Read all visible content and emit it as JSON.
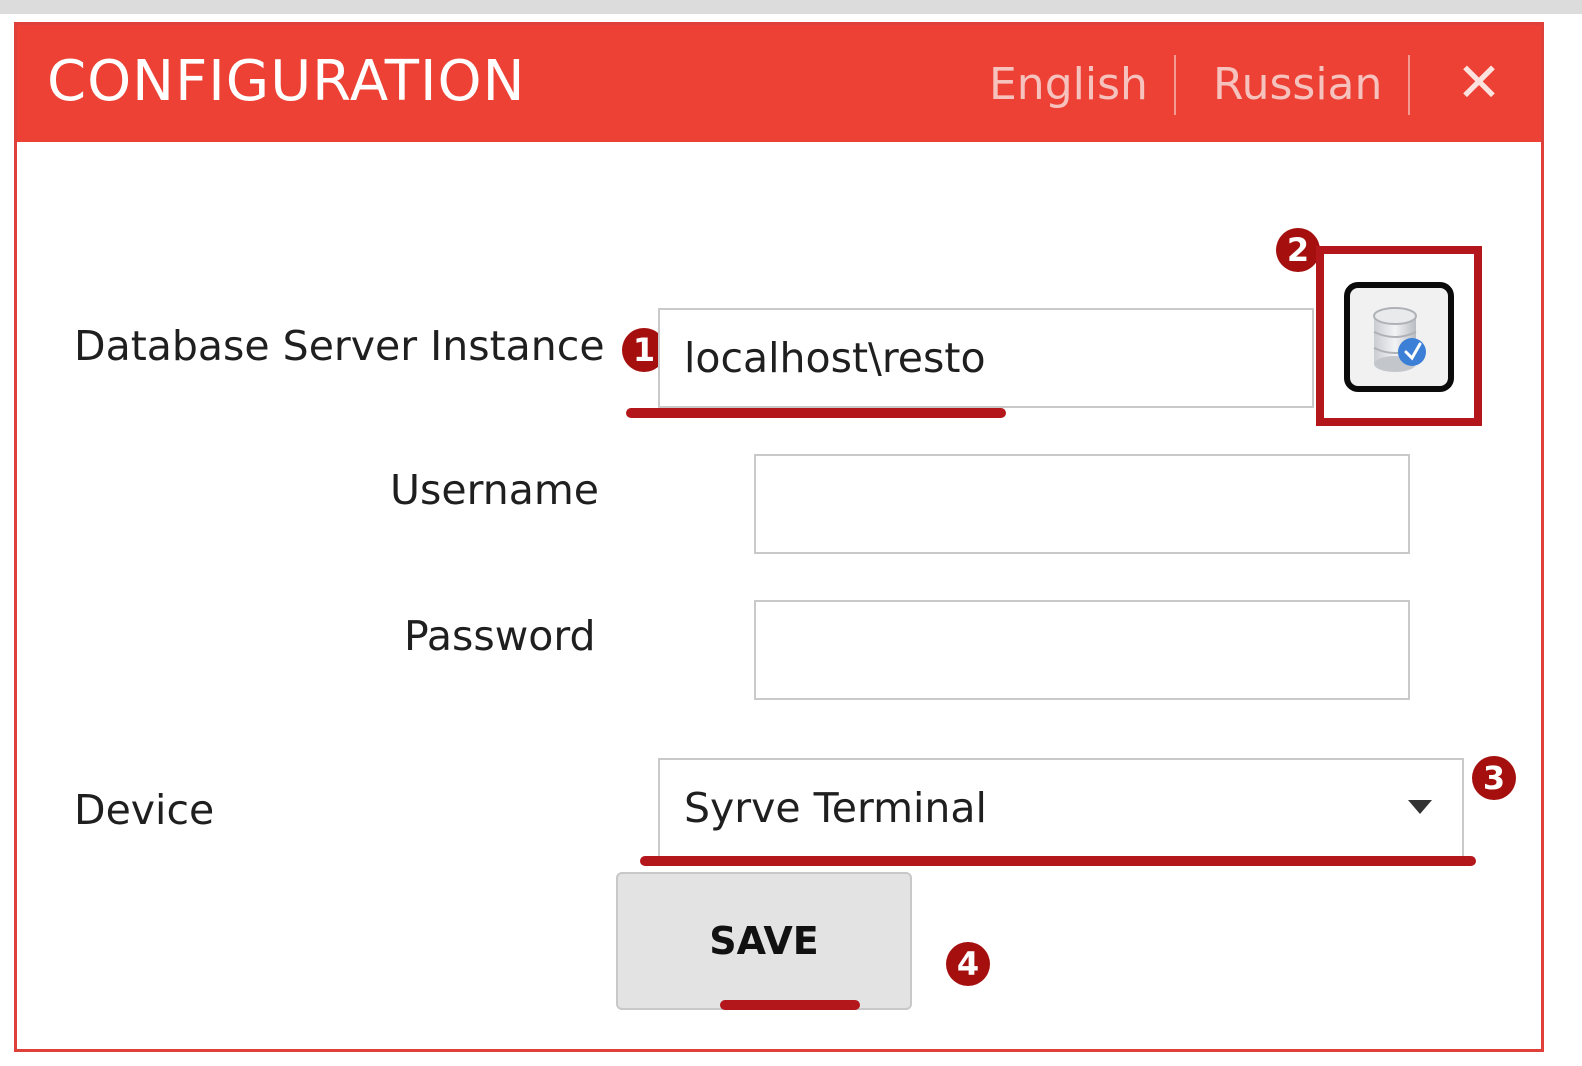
{
  "window": {
    "title": "CONFIGURATION",
    "languages": [
      "English",
      "Russian"
    ],
    "close_glyph": "✕"
  },
  "form": {
    "server_label": "Database Server Instance",
    "server_value": "localhost\\resto",
    "username_label": "Username",
    "username_value": "",
    "password_label": "Password",
    "password_value": "",
    "device_label": "Device",
    "device_value": "Syrve Terminal",
    "save_label": "SAVE"
  },
  "annotations": {
    "markers": [
      "1",
      "2",
      "3",
      "4"
    ],
    "accent_color": "#b3171b"
  },
  "icons": {
    "db_button": "database-connect-icon",
    "dropdown": "chevron-down-icon",
    "close": "close-icon"
  },
  "colors": {
    "titlebar": "#ec4134",
    "title_text": "#ffffff",
    "language_text": "#f6c2bd",
    "border": "#e0403a"
  }
}
